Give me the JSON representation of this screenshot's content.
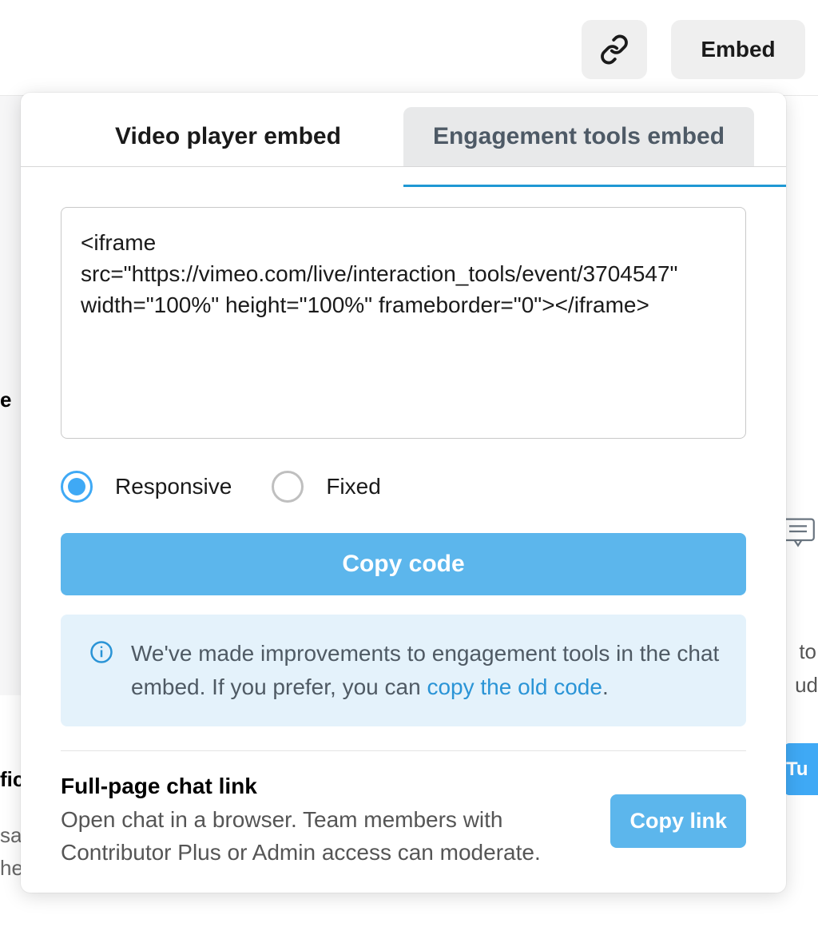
{
  "topbar": {
    "embed_label": "Embed"
  },
  "tabs": {
    "video_player": "Video player embed",
    "engagement_tools": "Engagement tools embed"
  },
  "code": "<iframe src=\"https://vimeo.com/live/interaction_tools/event/3704547\" width=\"100%\" height=\"100%\" frameborder=\"0\"></iframe>",
  "radios": {
    "responsive": "Responsive",
    "fixed": "Fixed"
  },
  "copy_code": "Copy code",
  "info": {
    "text_before": "We've made improvements to engagement tools in the chat embed. If you prefer, you can ",
    "link": "copy the old code",
    "text_after": "."
  },
  "fullpage": {
    "title": "Full-page chat link",
    "desc": "Open chat in a browser. Team members with Contributor Plus or Admin access can moderate.",
    "copy_link": "Copy link"
  },
  "background": {
    "left1": "e",
    "right1": "to",
    "right2": "ud",
    "right_blue": "Tu",
    "bottom_left1": "fic",
    "bottom_left2": "sa",
    "bottom_left3": "he"
  }
}
